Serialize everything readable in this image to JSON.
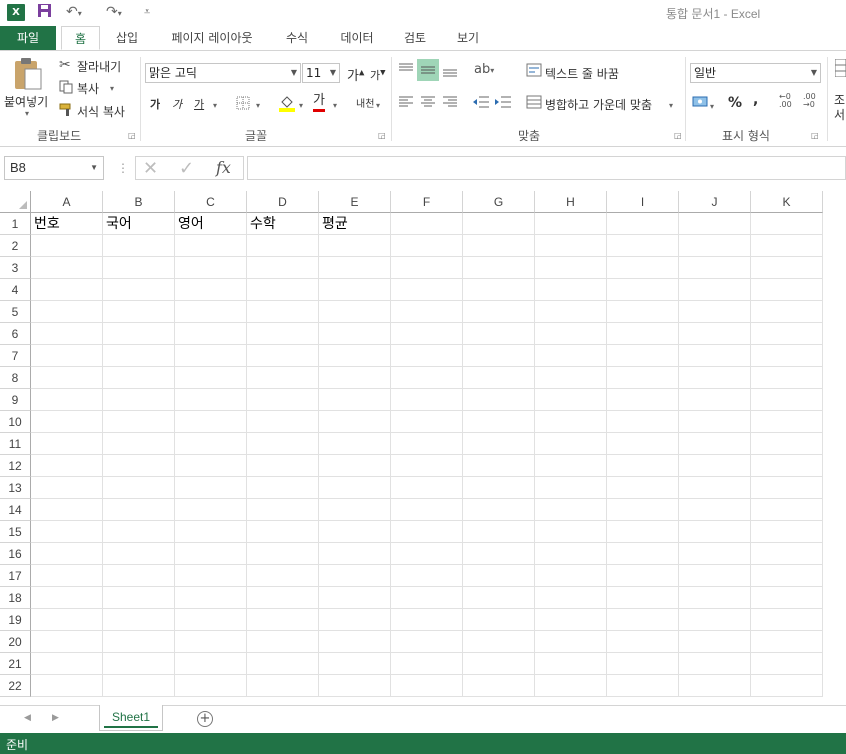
{
  "titlebar": {
    "app_icon": "excel-icon",
    "title": "통합 문서1 - Excel"
  },
  "tabs": [
    {
      "id": "file",
      "label": "파일"
    },
    {
      "id": "home",
      "label": "홈"
    },
    {
      "id": "insert",
      "label": "삽입"
    },
    {
      "id": "layout",
      "label": "페이지 레이아웃"
    },
    {
      "id": "formulas",
      "label": "수식"
    },
    {
      "id": "data",
      "label": "데이터"
    },
    {
      "id": "review",
      "label": "검토"
    },
    {
      "id": "view",
      "label": "보기"
    }
  ],
  "ribbon": {
    "clipboard": {
      "paste": "붙여넣기",
      "cut": "잘라내기",
      "copy": "복사",
      "format_painter": "서식 복사",
      "group": "클립보드"
    },
    "font": {
      "name": "맑은 고딕",
      "size": "11",
      "grow": "가",
      "shrink": "가",
      "bold": "가",
      "italic": "가",
      "underline": "가",
      "font_color": "가",
      "phonetic": "내천",
      "group": "글꼴"
    },
    "alignment": {
      "wrap_text": "텍스트 줄 바꿈",
      "merge_center": "병합하고 가운데 맞춤",
      "group": "맞춤"
    },
    "number": {
      "format": "일반",
      "percent": "%",
      "comma": ",",
      "group": "표시 형식"
    },
    "styles_partial": "조\n서"
  },
  "formula_bar": {
    "name_box": "B8",
    "fx": "fx",
    "value": ""
  },
  "grid": {
    "columns": [
      "A",
      "B",
      "C",
      "D",
      "E",
      "F",
      "G",
      "H",
      "I",
      "J",
      "K"
    ],
    "rows": [
      "1",
      "2",
      "3",
      "4",
      "5",
      "6",
      "7",
      "8",
      "9",
      "10",
      "11",
      "12",
      "13",
      "14",
      "15",
      "16",
      "17",
      "18",
      "19",
      "20",
      "21",
      "22"
    ],
    "cells": {
      "A1": "번호",
      "B1": "국어",
      "C1": "영어",
      "D1": "수학",
      "E1": "평균"
    }
  },
  "sheets": {
    "active": "Sheet1"
  },
  "status": {
    "text": "준비"
  },
  "colors": {
    "accent": "#217346",
    "gridline": "#e1e1e1",
    "header_border": "#ababab"
  }
}
